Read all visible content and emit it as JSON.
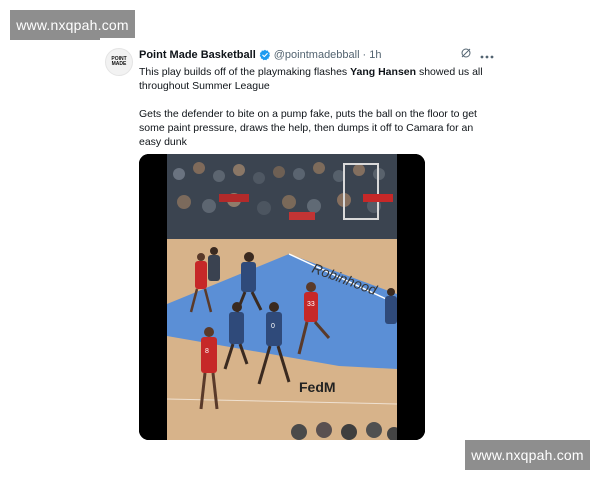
{
  "watermark": {
    "top": "www.nxqpah.com",
    "bottom": "www.nxqpah.com"
  },
  "tweet": {
    "avatar_text": [
      "POINT",
      "MADE"
    ],
    "display_name": "Point Made Basketball",
    "handle": "@pointmadebball",
    "separator": "·",
    "time": "1h",
    "body": {
      "p1_before": "This play builds off of the playmaking flashes ",
      "p1_bold": "Yang Hansen",
      "p1_after": " showed us all throughout Summer League",
      "p2": "Gets the defender to bite on a pump fake, puts the ball on the floor to get some paint pressure, draws the help, then dumps it off to Camara for an easy dunk"
    },
    "icons": {
      "verified": "verified-badge-icon",
      "grok": "grok-icon",
      "more": "more-icon"
    },
    "colors": {
      "verified": "#1d9bf0",
      "handle": "#536471"
    }
  },
  "media": {
    "court_text": [
      "Robinhood",
      "FedM"
    ],
    "jersey_numbers": [
      "33",
      "8",
      "0"
    ]
  }
}
